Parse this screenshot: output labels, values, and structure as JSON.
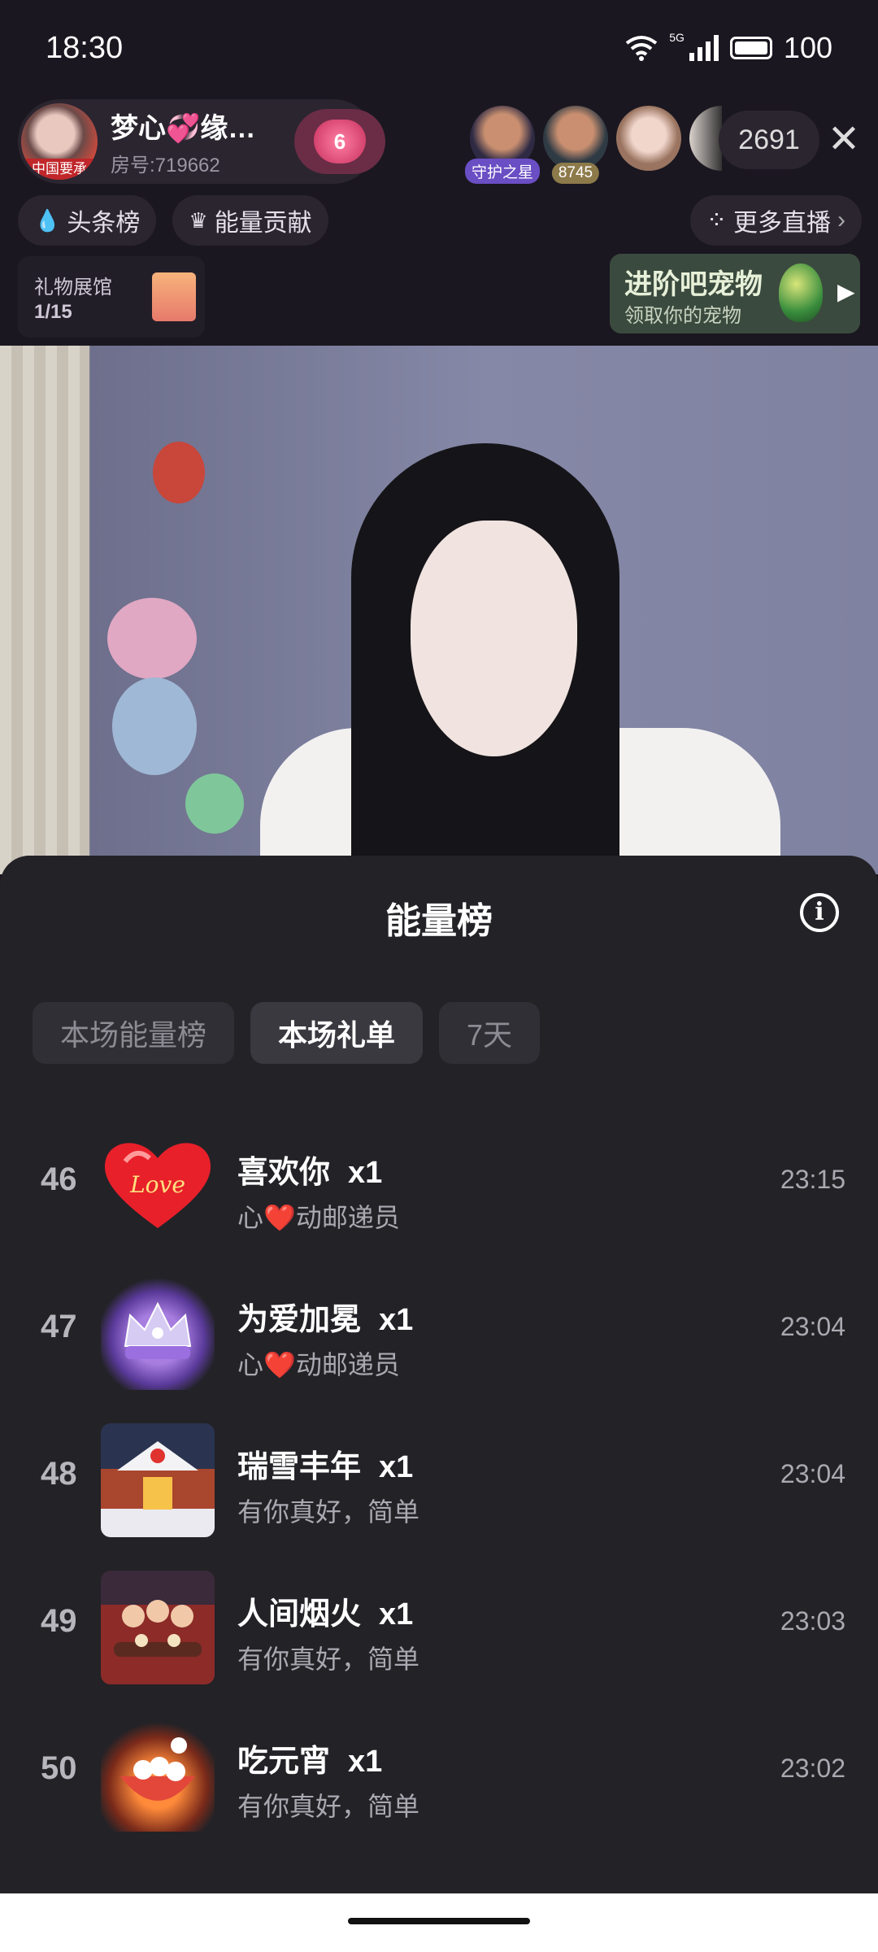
{
  "status_bar": {
    "time": "18:30",
    "battery": "100",
    "network": "5G"
  },
  "host": {
    "name": "梦心💞缘…",
    "room": "房号:719662",
    "badge_text": "中国要承",
    "fans_level": "6"
  },
  "viewers": [
    {
      "badge": "守护之星",
      "color": "#6a4ec4"
    },
    {
      "badge": "8745",
      "color": "#8d7a4a"
    },
    {
      "badge": "",
      "color": ""
    },
    {
      "badge": "",
      "color": ""
    }
  ],
  "viewer_count": "2691",
  "chips": {
    "headline": "头条榜",
    "energy": "能量贡献",
    "more_live": "更多直播"
  },
  "gift_hall": {
    "title": "礼物展馆",
    "progress": "1/15"
  },
  "pet_banner": {
    "title": "进阶吧宠物",
    "subtitle": "领取你的宠物"
  },
  "sheet": {
    "title": "能量榜",
    "tabs": [
      {
        "label": "本场能量榜",
        "active": false
      },
      {
        "label": "本场礼单",
        "active": true
      },
      {
        "label": "7天",
        "active": false
      }
    ],
    "items": [
      {
        "rank": "46",
        "gift": "喜欢你",
        "qty": "x1",
        "sender": "心❤️动邮递员",
        "time": "23:15",
        "icon": "love-heart-icon"
      },
      {
        "rank": "47",
        "gift": "为爱加冕",
        "qty": "x1",
        "sender": "心❤️动邮递员",
        "time": "23:04",
        "icon": "crown-icon"
      },
      {
        "rank": "48",
        "gift": "瑞雪丰年",
        "qty": "x1",
        "sender": "有你真好，简单",
        "time": "23:04",
        "icon": "snow-house-icon"
      },
      {
        "rank": "49",
        "gift": "人间烟火",
        "qty": "x1",
        "sender": "有你真好，简单",
        "time": "23:03",
        "icon": "family-dinner-icon"
      },
      {
        "rank": "50",
        "gift": "吃元宵",
        "qty": "x1",
        "sender": "有你真好，简单",
        "time": "23:02",
        "icon": "yuanxiao-bowl-icon"
      }
    ]
  }
}
